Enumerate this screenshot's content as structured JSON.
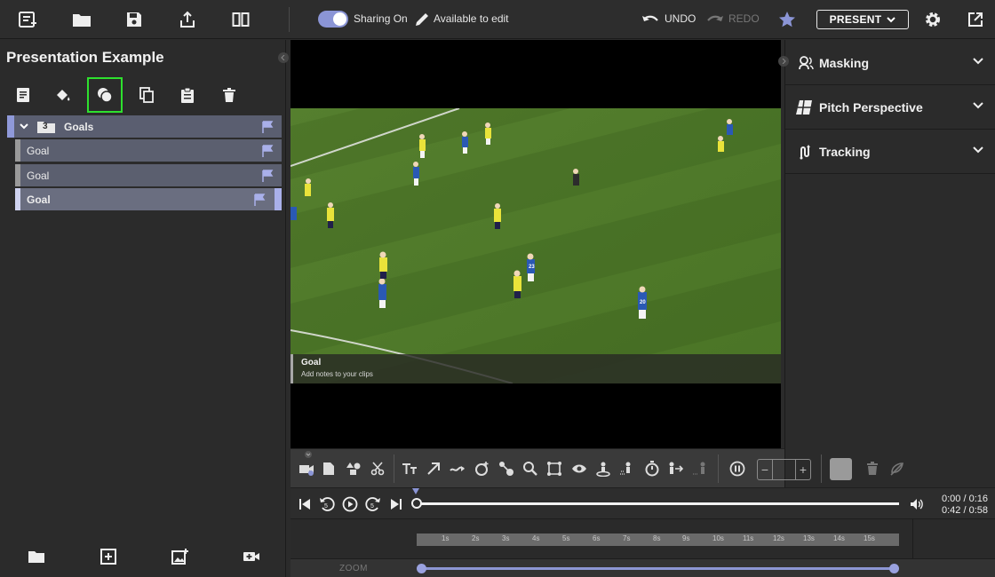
{
  "topbar": {
    "sharing_label": "Sharing On",
    "edit_label": "Available to edit",
    "undo_label": "UNDO",
    "redo_label": "REDO",
    "present_label": "PRESENT"
  },
  "left_panel": {
    "title": "Presentation Example",
    "group": {
      "count": "3",
      "label": "Goals"
    },
    "clips": [
      {
        "label": "Goal"
      },
      {
        "label": "Goal"
      },
      {
        "label": "Goal"
      }
    ]
  },
  "video": {
    "caption_title": "Goal",
    "caption_subtitle": "Add notes to your clips",
    "players": [
      {
        "number": "23"
      },
      {
        "number": "20"
      }
    ]
  },
  "right_panel": {
    "sections": [
      {
        "label": "Masking",
        "icon": "mask-icon"
      },
      {
        "label": "Pitch Perspective",
        "icon": "pitch-perspective-icon"
      },
      {
        "label": "Tracking",
        "icon": "tracking-icon"
      }
    ]
  },
  "playback": {
    "time_clip": "0:00 / 0:16",
    "time_total": "0:42 / 0:58",
    "progress": 0.0
  },
  "timeline": {
    "ticks": [
      "1s",
      "2s",
      "3s",
      "4s",
      "5s",
      "6s",
      "7s",
      "8s",
      "9s",
      "10s",
      "11s",
      "12s",
      "13s",
      "14s",
      "15s"
    ]
  },
  "zoom": {
    "label": "ZOOM"
  },
  "colors": {
    "accent": "#8b95d6",
    "selected_outline": "#2ee02e",
    "pitch": "#4f7a2a"
  }
}
